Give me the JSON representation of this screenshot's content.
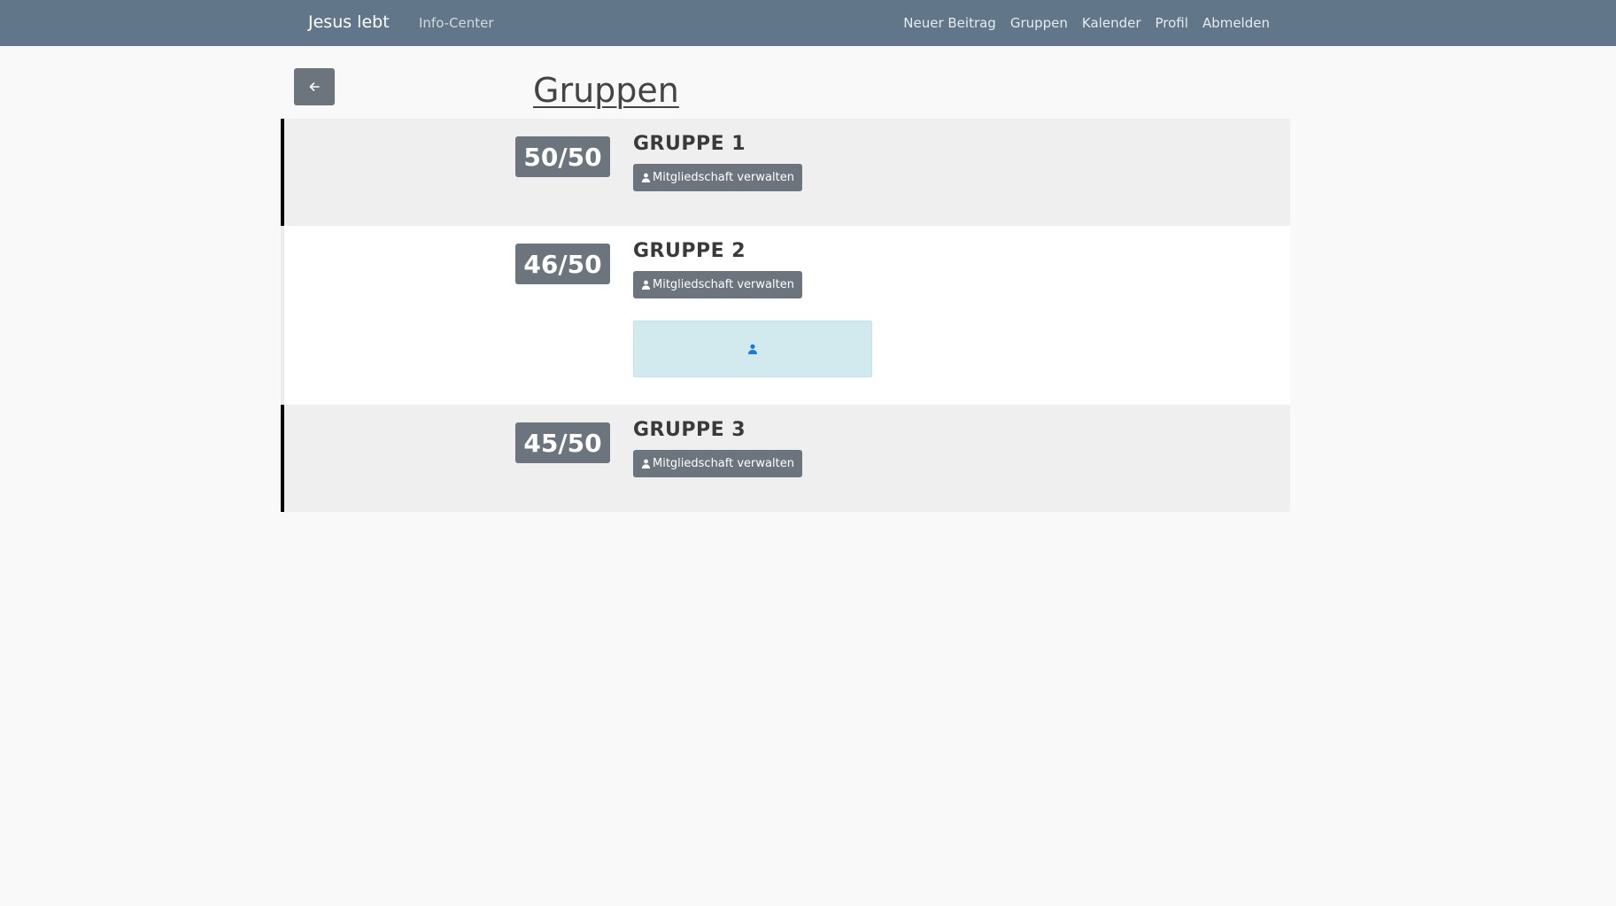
{
  "navbar": {
    "brand": "Jesus lebt",
    "left_link": "Info-Center",
    "right_links": [
      "Neuer Beitrag",
      "Gruppen",
      "Kalender",
      "Profil",
      "Abmelden"
    ]
  },
  "page": {
    "back_icon": "arrow-left-icon",
    "title": "Gruppen"
  },
  "groups": [
    {
      "count": "50/50",
      "name": "GRUPPE 1",
      "button_label": "Mitgliedschaft verwalten",
      "button_icon": "user-icon"
    },
    {
      "count": "46/50",
      "name": "GRUPPE 2",
      "button_label": "Mitgliedschaft verwalten",
      "button_icon": "user-icon",
      "member_box_icon": "user-icon"
    },
    {
      "count": "45/50",
      "name": "GRUPPE 3",
      "button_label": "Mitgliedschaft verwalten",
      "button_icon": "user-icon"
    }
  ],
  "colors": {
    "navbar": "#617789",
    "badge": "#6c757d",
    "info_box": "#d2e9ee",
    "info_icon": "#1a7bd6"
  }
}
